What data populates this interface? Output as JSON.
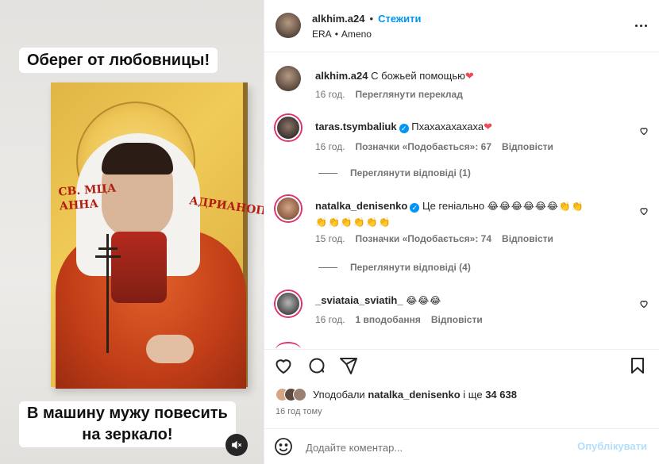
{
  "media": {
    "caption_top": "Оберег от любовницы!",
    "caption_bottom_line1": "В машину мужу повесить",
    "caption_bottom_line2": "на зеркало!",
    "icon_text_left_line1": "СВ. МЦА",
    "icon_text_left_line2": "АННА",
    "icon_text_right": "АДРИАНОП",
    "mute_icon": "speaker-muted-icon"
  },
  "header": {
    "username": "alkhim.a24",
    "separator": "•",
    "follow_label": "Стежити",
    "audio_artist": "ERA",
    "audio_separator": "•",
    "audio_track": "Ameno",
    "more_icon": "more-horizontal-icon"
  },
  "caption_comment": {
    "username": "alkhim.a24",
    "text": "С божьей помощью",
    "emoji": "❤",
    "time": "16 год.",
    "translate_label": "Переглянути переклад"
  },
  "comments": [
    {
      "username": "taras.tsymbaliuk",
      "verified": true,
      "text": "Пхахахахахаха",
      "emoji": "❤",
      "time": "16 год.",
      "likes": "Позначки «Подобається»: 67",
      "reply_label": "Відповісти",
      "view_replies": "Переглянути відповіді (1)"
    },
    {
      "username": "natalka_denisenko",
      "verified": true,
      "text": "Це геніально",
      "emoji_line1": "😂😂😂😂😂😂👏👏",
      "emoji_line2": "👏👏👏👏👏👏",
      "time": "15 год.",
      "likes": "Позначки «Подобається»: 74",
      "reply_label": "Відповісти",
      "view_replies": "Переглянути відповіді (4)"
    },
    {
      "username": "_sviataia_sviatih_",
      "verified": false,
      "text": "",
      "emoji": "😂😂😂",
      "time": "16 год.",
      "likes": "1 вподобання",
      "reply_label": "Відповісти"
    }
  ],
  "actions": {
    "like_icon": "heart-icon",
    "comment_icon": "comment-icon",
    "share_icon": "share-icon",
    "save_icon": "bookmark-icon",
    "liked_by_prefix": "Уподобали",
    "liked_by_user": "natalka_denisenko",
    "liked_by_and": "і ще",
    "liked_by_count": "34 638",
    "time": "16 год тому"
  },
  "add_comment": {
    "emoji_icon": "smiley-icon",
    "placeholder": "Додайте коментар...",
    "publish_label": "Опублікувати"
  },
  "colors": {
    "accent": "#0095f6",
    "publish_disabled": "#b2dffc",
    "heart": "#ed4956",
    "story_ring": "#e12f6c"
  }
}
